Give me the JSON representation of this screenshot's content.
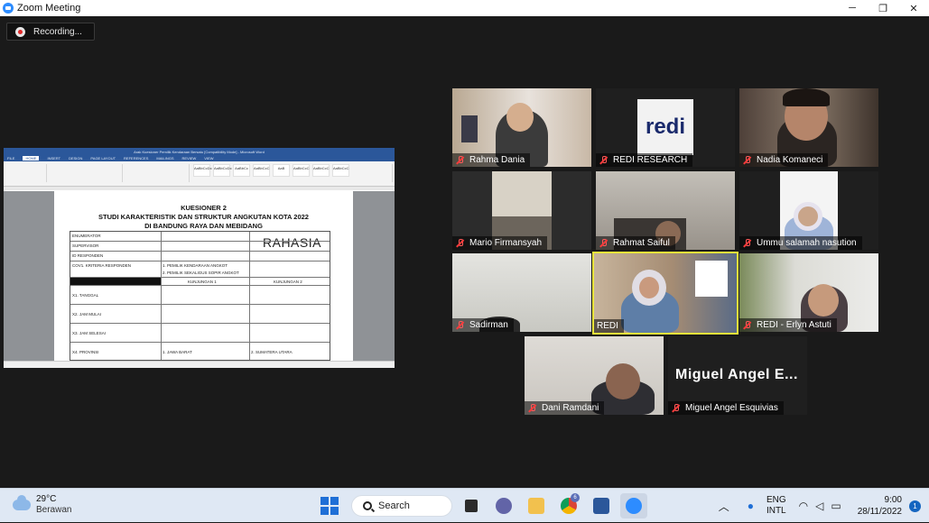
{
  "window": {
    "title": "Zoom Meeting",
    "minimize": "─",
    "maximize": "❐",
    "close": "✕"
  },
  "recording": {
    "label": "Recording..."
  },
  "shared_screen": {
    "word_title": "Arak Kuesioner Pemilik Kendaraan Bersatu [Compatibility Mode] - Microsoft Word",
    "tabs": [
      "FILE",
      "HOME",
      "INSERT",
      "DESIGN",
      "PAGE LAYOUT",
      "REFERENCES",
      "MAILINGS",
      "REVIEW",
      "VIEW"
    ],
    "styles": [
      "AaBbCcDc",
      "AaBbCcDc",
      "AaBbCc",
      "AaBbCcC",
      "AaB",
      "AaBbCcC",
      "AaBbCcC",
      "AaBbCcC"
    ],
    "doc": {
      "heading1": "KUESIONER 2",
      "heading2": "STUDI KARAKTERISTIK DAN STRUKTUR ANGKUTAN KOTA 2022",
      "heading3": "DI BANDUNG RAYA DAN MEBIDANG",
      "stamp": "RAHASIA",
      "rows": [
        {
          "c1": "ENUMERATOR",
          "c2": "",
          "c3": ""
        },
        {
          "c1": "SUPERVISOR",
          "c2": "",
          "c3": ""
        },
        {
          "c1": "ID RESPONDEN",
          "c2": "",
          "c3": ""
        },
        {
          "c1": "COV1. KRITERIA RESPONDEN",
          "c2": "1. PEMILIK KENDARAAN ANGKOT",
          "c3": ""
        },
        {
          "c1": "",
          "c2": "2. PEMILIK SEKALIGUS SOPIR ANGKOT",
          "c3": ""
        },
        {
          "c1": "",
          "c2": "KUNJUNGAN 1",
          "c3": "KUNJUNGAN 2"
        },
        {
          "c1": "X1. TANGGAL",
          "c2": "",
          "c3": ""
        },
        {
          "c1": "X2. JAM MULAI",
          "c2": "",
          "c3": ""
        },
        {
          "c1": "X3. JAM SELESAI",
          "c2": "",
          "c3": ""
        },
        {
          "c1": "X4. PROVINSI",
          "c2": "1. JAWA BARAT",
          "c3": "2. SUMATERA UTARA"
        }
      ]
    }
  },
  "participants": [
    {
      "name": "Rahma Dania",
      "muted": true
    },
    {
      "name": "REDI RESEARCH",
      "muted": true,
      "logo": "redi"
    },
    {
      "name": "Nadia Komaneci",
      "muted": true
    },
    {
      "name": "Mario Firmansyah",
      "muted": true
    },
    {
      "name": "Rahmat Saiful",
      "muted": true
    },
    {
      "name": "Ummu salamah nasution",
      "muted": true
    },
    {
      "name": "Sadirman",
      "muted": true
    },
    {
      "name": "REDI",
      "muted": false,
      "active_speaker": true
    },
    {
      "name": "REDI - Erlyn Astuti",
      "muted": true
    },
    {
      "name": "Dani Ramdani",
      "muted": true
    },
    {
      "name": "Miguel Angel Esquivias",
      "muted": true,
      "display_name": "Miguel Angel E..."
    }
  ],
  "taskbar": {
    "weather_temp": "29°C",
    "weather_desc": "Berawan",
    "search": "Search",
    "lang1": "ENG",
    "lang2": "INTL",
    "time": "9:00",
    "date": "28/11/2022",
    "notif_count": "1",
    "chrome_badge": "6",
    "accent": "#1f6fd6"
  }
}
